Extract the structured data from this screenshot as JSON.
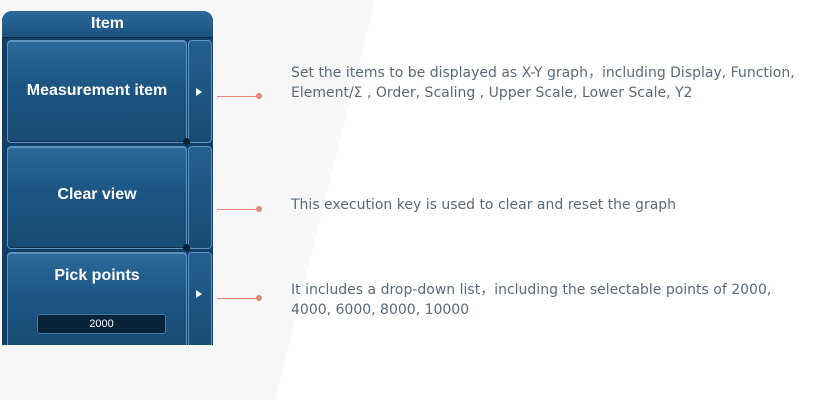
{
  "menu": {
    "title": "Item",
    "keys": [
      {
        "label": "Measurement item"
      },
      {
        "label": "Clear view"
      },
      {
        "label": "Pick points",
        "value": "2000"
      }
    ]
  },
  "descriptions": [
    {
      "text": "Set the items to be displayed as X-Y graph，including Display, Function, Element/Σ , Order, Scaling , Upper Scale, Lower Scale, Y2"
    },
    {
      "text": "This execution key is used to clear and reset the graph"
    },
    {
      "text": "It includes a drop-down list，including the selectable points of  2000, 4000, 6000, 8000, 10000"
    }
  ],
  "colors": {
    "panel": "#0f3f66",
    "key": "#1c5582",
    "connector": "#e08a75",
    "description_text": "#5a6a78"
  },
  "icons": [
    "arrow-right-icon"
  ]
}
